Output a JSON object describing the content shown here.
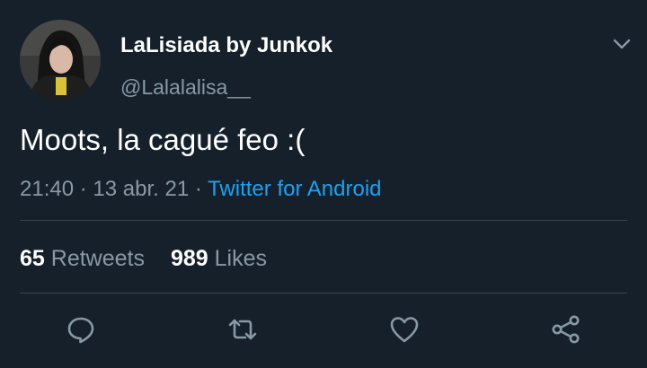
{
  "tweet": {
    "author": {
      "display_name": "LaLisiada by Junkok",
      "handle": "@Lalalalisa__"
    },
    "text": "Moots, la cagué feo :(",
    "time": "21:40",
    "date": "13 abr. 21",
    "separator": "·",
    "source": "Twitter for Android",
    "stats": {
      "retweets_count": "65",
      "retweets_label": "Retweets",
      "likes_count": "989",
      "likes_label": "Likes"
    }
  },
  "icons": {
    "menu": "chevron-down-icon",
    "reply": "reply-icon",
    "retweet": "retweet-icon",
    "like": "heart-icon",
    "share": "share-icon"
  },
  "colors": {
    "background": "#15202b",
    "secondary_text": "#8899a6",
    "link": "#1da1f2",
    "divider": "#38444d"
  }
}
